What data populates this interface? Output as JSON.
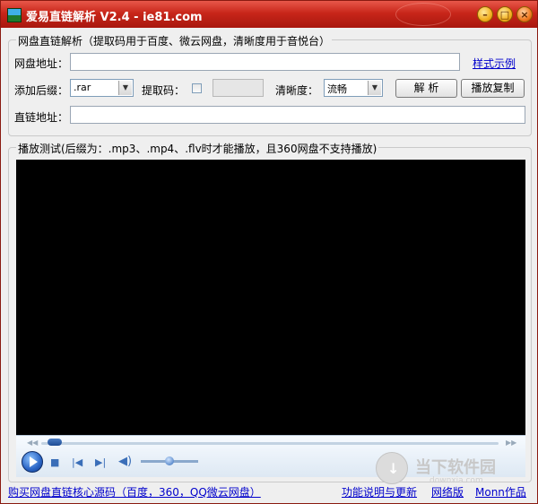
{
  "window": {
    "title": "爱易直链解析 V2.4 - ie81.com",
    "buttons": {
      "minimize": "–",
      "maximize": "□",
      "close": "×"
    }
  },
  "parse_group": {
    "legend": "网盘直链解析（提取码用于百度、微云网盘，清晰度用于音悦台）",
    "url_label": "网盘地址：",
    "url_value": "",
    "style_example_link": "样式示例",
    "suffix_label": "添加后缀：",
    "suffix_value": ".rar",
    "code_label": "提取码：",
    "code_value": "",
    "quality_label": "清晰度：",
    "quality_value": "流畅",
    "parse_button": "解 析",
    "play_copy_button": "播放复制",
    "direct_label": "直链地址：",
    "direct_value": ""
  },
  "player_group": {
    "legend": "播放测试(后缀为：.mp3、.mp4、.flv时才能播放，且360网盘不支持播放)",
    "seek_progress": 0.03,
    "volume_level": 0.5
  },
  "footer": {
    "buy_link": "购买网盘直链核心源码（百度，360，QQ微云网盘）",
    "help_link": "功能说明与更新",
    "web_link": "网络版",
    "author_link": "Monn作品"
  },
  "watermark": {
    "text": "当下软件园",
    "sub": "downxia.com"
  }
}
